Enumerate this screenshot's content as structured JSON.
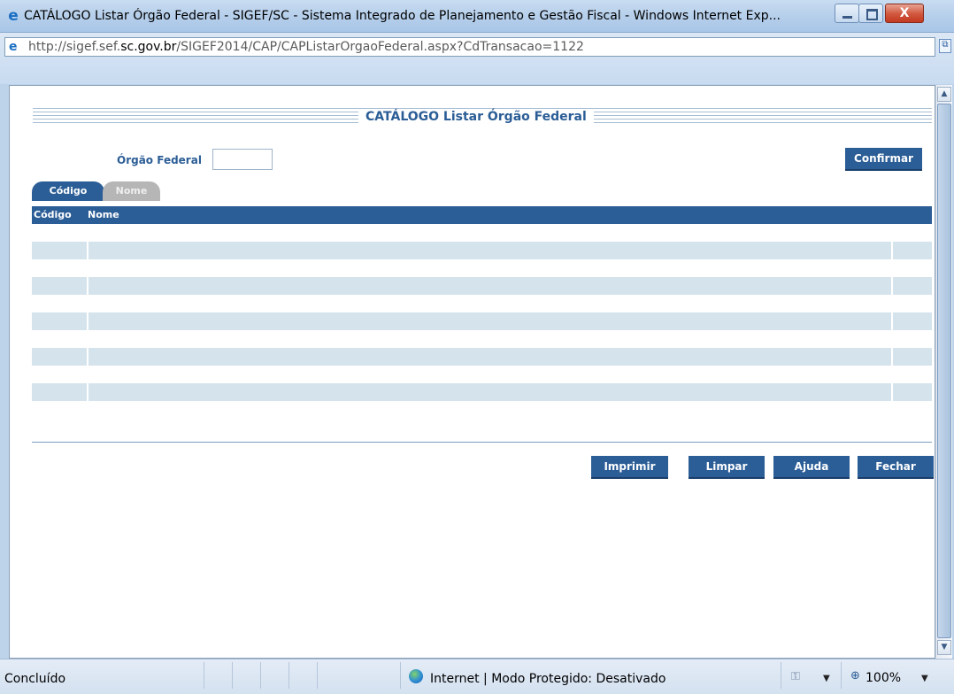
{
  "window": {
    "title": "CATÁLOGO Listar Órgão Federal - SIGEF/SC - Sistema Integrado de Planejamento e Gestão Fiscal - Windows Internet Exp...",
    "close_glyph": "X"
  },
  "address": {
    "url_prefix": "http://sigef.sef.",
    "url_domain": "sc.gov.br",
    "url_suffix": "/SIGEF2014/CAP/CAPListarOrgaoFederal.aspx?CdTransacao=1122"
  },
  "page": {
    "title": "CATÁLOGO Listar Órgão Federal",
    "filter_label": "Órgão Federal",
    "filter_value": "",
    "confirm_label": "Confirmar"
  },
  "tabs": [
    {
      "label": "Código",
      "active": true
    },
    {
      "label": "Nome",
      "active": false
    }
  ],
  "grid": {
    "columns": [
      "Código",
      "Nome"
    ],
    "rows": [
      {
        "codigo": "",
        "nome": ""
      },
      {
        "codigo": "",
        "nome": ""
      },
      {
        "codigo": "",
        "nome": ""
      },
      {
        "codigo": "",
        "nome": ""
      },
      {
        "codigo": "",
        "nome": ""
      }
    ]
  },
  "actions": {
    "print_label": "Imprimir",
    "clear_label": "Limpar",
    "help_label": "Ajuda",
    "close_label": "Fechar"
  },
  "status": {
    "text": "Concluído",
    "zone": "Internet | Modo Protegido: Desativado",
    "zoom": "100%"
  },
  "colors": {
    "accent": "#2b5d96",
    "row_fill": "#d5e3ec",
    "tab_inactive": "#b6b6b6"
  },
  "icons": {
    "browser": "ie-icon",
    "page": "page-icon",
    "zone": "globe-icon",
    "zoom": "magnifier-icon"
  }
}
